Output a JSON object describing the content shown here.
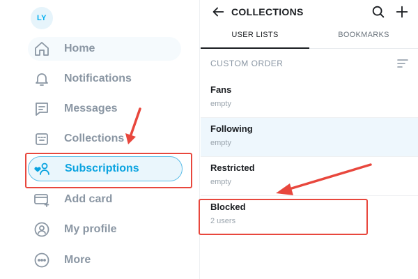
{
  "sidebar": {
    "avatar_initials": "LY",
    "items": [
      {
        "label": "Home",
        "icon": "home-icon"
      },
      {
        "label": "Notifications",
        "icon": "bell-icon"
      },
      {
        "label": "Messages",
        "icon": "message-icon"
      },
      {
        "label": "Collections",
        "icon": "collections-icon"
      },
      {
        "label": "Subscriptions",
        "icon": "subscriptions-icon",
        "active": true
      },
      {
        "label": "Add card",
        "icon": "card-icon"
      },
      {
        "label": "My profile",
        "icon": "profile-icon"
      },
      {
        "label": "More",
        "icon": "more-icon"
      }
    ]
  },
  "main": {
    "title": "COLLECTIONS",
    "tabs": [
      {
        "label": "USER LISTS",
        "active": true
      },
      {
        "label": "BOOKMARKS",
        "active": false
      }
    ],
    "section_heading": "CUSTOM ORDER",
    "lists": [
      {
        "title": "Fans",
        "subtitle": "empty"
      },
      {
        "title": "Following",
        "subtitle": "empty",
        "highlighted": true
      },
      {
        "title": "Restricted",
        "subtitle": "empty"
      },
      {
        "title": "Blocked",
        "subtitle": "2 users"
      }
    ]
  },
  "colors": {
    "accent": "#00aff0",
    "annotation": "#e8473d",
    "text_primary": "#1b1e22",
    "text_muted": "#8a96a3"
  }
}
